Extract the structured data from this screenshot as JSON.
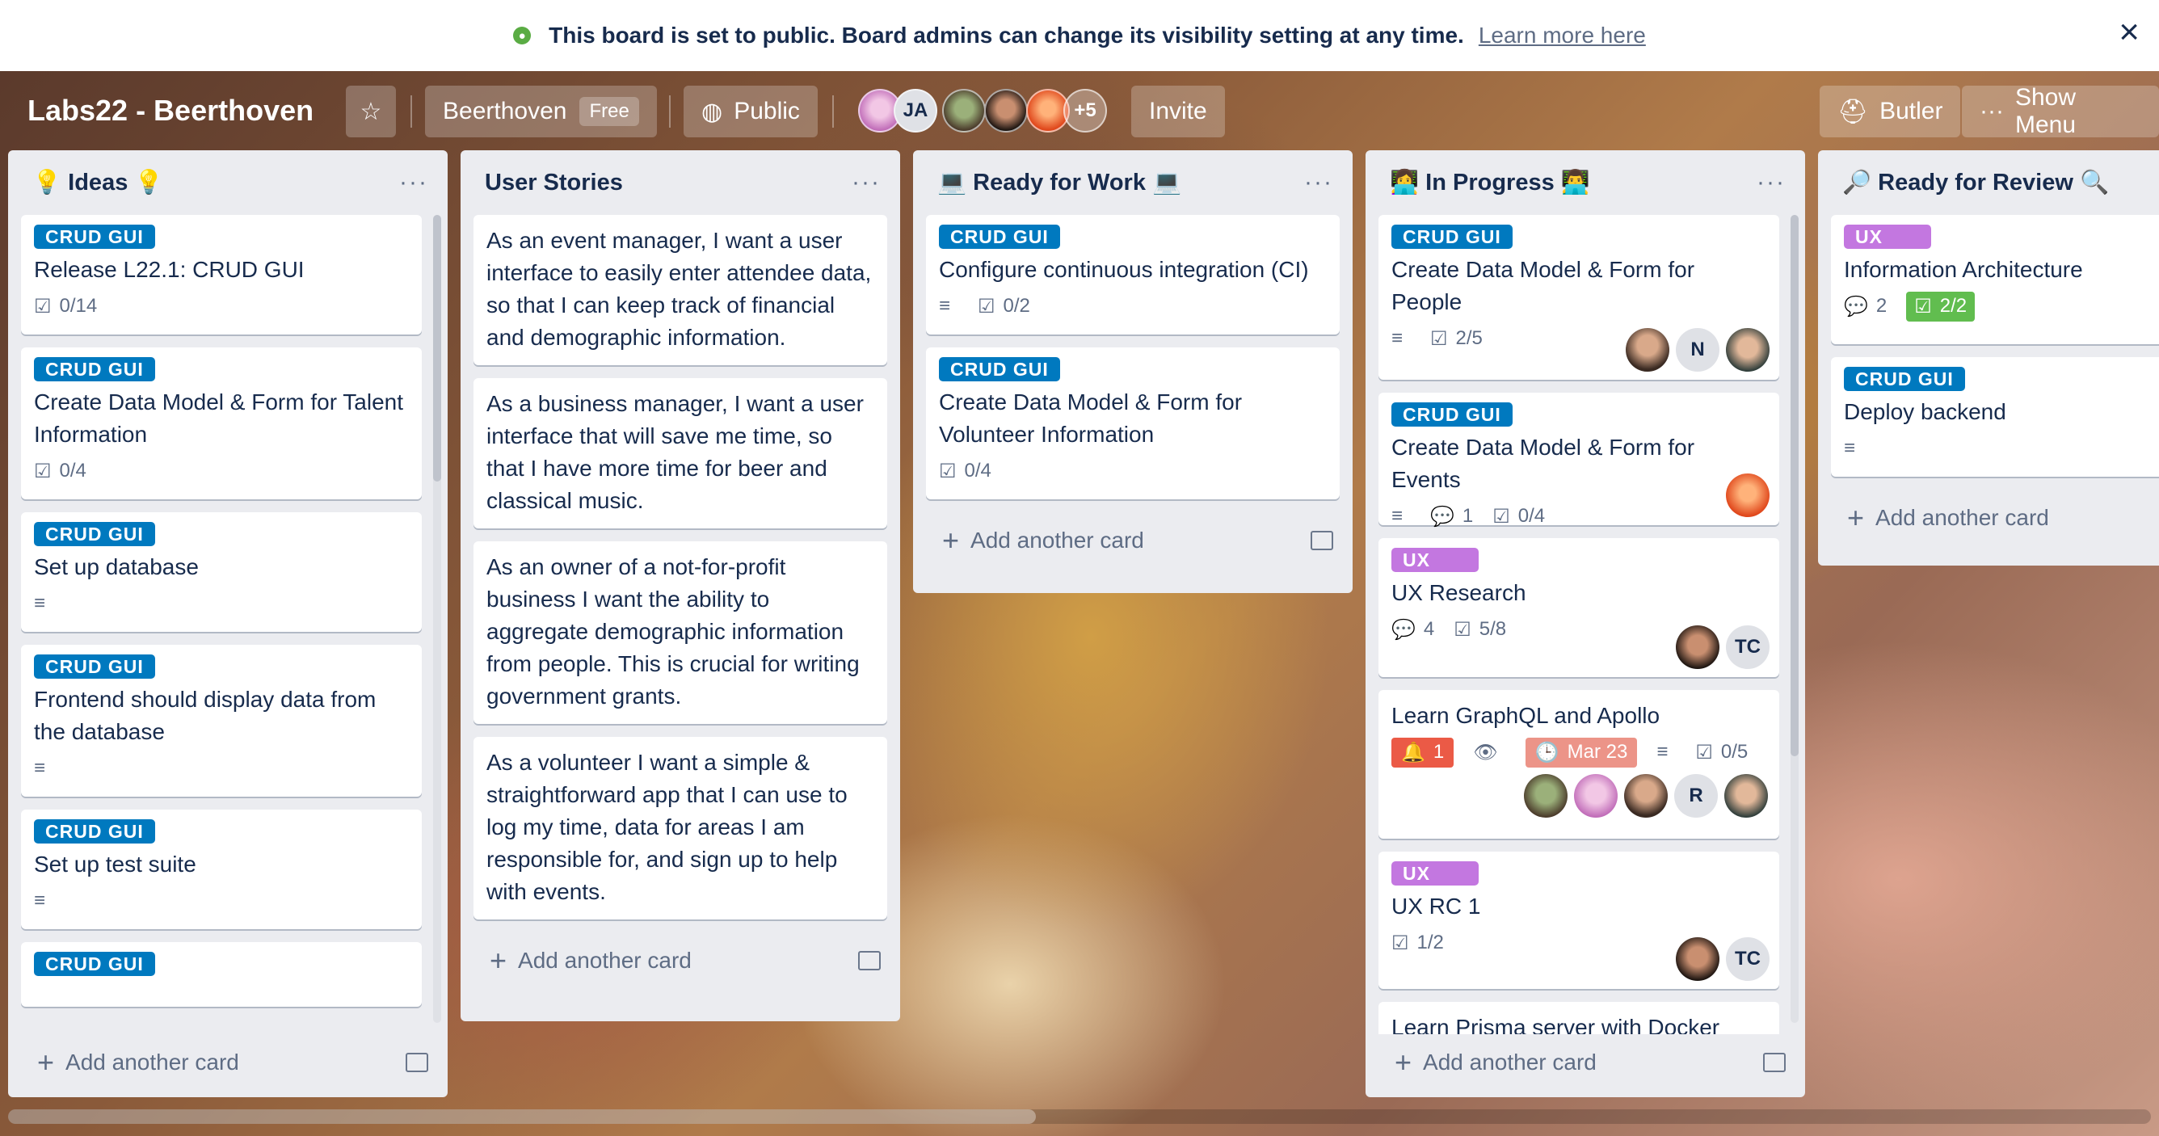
{
  "banner": {
    "message": "This board is set to public. Board admins can change its visibility setting at any time.",
    "link": "Learn more here",
    "close": "×"
  },
  "header": {
    "board_title": "Labs22 - Beerthoven",
    "star": "☆",
    "team_name": "Beerthoven",
    "team_plan": "Free",
    "visibility": "Public",
    "members": [
      {
        "initials": ""
      },
      {
        "initials": "JA"
      },
      {
        "initials": ""
      },
      {
        "initials": ""
      },
      {
        "initials": ""
      }
    ],
    "more_members": "+5",
    "invite": "Invite",
    "butler": "Butler",
    "show_menu": "Show Menu"
  },
  "lists": [
    {
      "title": "💡 Ideas 💡",
      "cards": [
        {
          "label": "CRUD GUI",
          "title": "Release L22.1: CRUD GUI",
          "checklist": "0/14"
        },
        {
          "label": "CRUD GUI",
          "title": "Create Data Model & Form for Talent Information",
          "checklist": "0/4"
        },
        {
          "label": "CRUD GUI",
          "title": "Set up database"
        },
        {
          "label": "CRUD GUI",
          "title": "Frontend should display data from the database"
        },
        {
          "label": "CRUD GUI",
          "title": "Set up test suite"
        },
        {
          "label": "CRUD GUI",
          "title": ""
        }
      ],
      "add_card": "Add another card"
    },
    {
      "title": "User Stories",
      "cards": [
        {
          "title": "As an event manager, I want a user interface to easily enter attendee data, so that I can keep track of financial and demographic information."
        },
        {
          "title": "As a business manager, I want a user interface that will save me time, so that I have more time for beer and classical music."
        },
        {
          "title": "As an owner of a not-for-profit business I want the ability to aggregate demographic information from people. This is crucial for writing government grants."
        },
        {
          "title": "As a volunteer I want a simple & straightforward app that I can use to log my time, data for areas I am responsible for, and sign up to help with events."
        }
      ],
      "add_card": "Add another card"
    },
    {
      "title": "💻 Ready for Work 💻",
      "cards": [
        {
          "label": "CRUD GUI",
          "title": "Configure continuous integration (CI)",
          "checklist": "0/2"
        },
        {
          "label": "CRUD GUI",
          "title": "Create Data Model & Form for Volunteer Information",
          "checklist": "0/4"
        }
      ],
      "add_card": "Add another card"
    },
    {
      "title": "👩‍💻 In Progress 👨‍💻",
      "cards": [
        {
          "label": "CRUD GUI",
          "title": "Create Data Model & Form for People",
          "checklist": "2/5",
          "members": [
            "",
            "N",
            ""
          ]
        },
        {
          "label": "CRUD GUI",
          "title": "Create Data Model & Form for Events",
          "comments": "1",
          "checklist": "0/4"
        },
        {
          "label": "UX",
          "title": "UX Research",
          "comments": "4",
          "checklist": "5/8",
          "members": [
            "",
            "TC"
          ]
        },
        {
          "title": "Learn GraphQL and Apollo",
          "notifications": "1",
          "due": "Mar 23",
          "checklist": "0/5",
          "members": [
            "",
            "",
            "",
            "R",
            ""
          ]
        },
        {
          "label": "UX",
          "title": "UX RC 1",
          "checklist": "1/2",
          "members": [
            "",
            "TC"
          ]
        },
        {
          "title": "Learn Prisma server with Docker"
        }
      ],
      "add_card": "Add another card"
    },
    {
      "title": "🔎 Ready for Review 🔍",
      "cards": [
        {
          "label": "UX",
          "title": "Information Architecture",
          "comments": "2",
          "checklist": "2/2"
        },
        {
          "label": "CRUD GUI",
          "title": "Deploy backend"
        }
      ],
      "add_card": "Add another card"
    }
  ],
  "colors": {
    "label_blue": "#0079bf",
    "label_purple": "#c377e0",
    "badge_green": "#61bd4f",
    "badge_red": "#eb5a46",
    "due_soon": "#ec9488"
  },
  "icons": {
    "globe": "globe-icon",
    "close": "close-icon",
    "star": "star-icon",
    "checklist": "checklist-icon",
    "description": "description-icon",
    "comment": "comment-icon",
    "watch": "eye-icon",
    "clock": "clock-icon",
    "bell": "bell-icon",
    "template": "card-template-icon"
  }
}
